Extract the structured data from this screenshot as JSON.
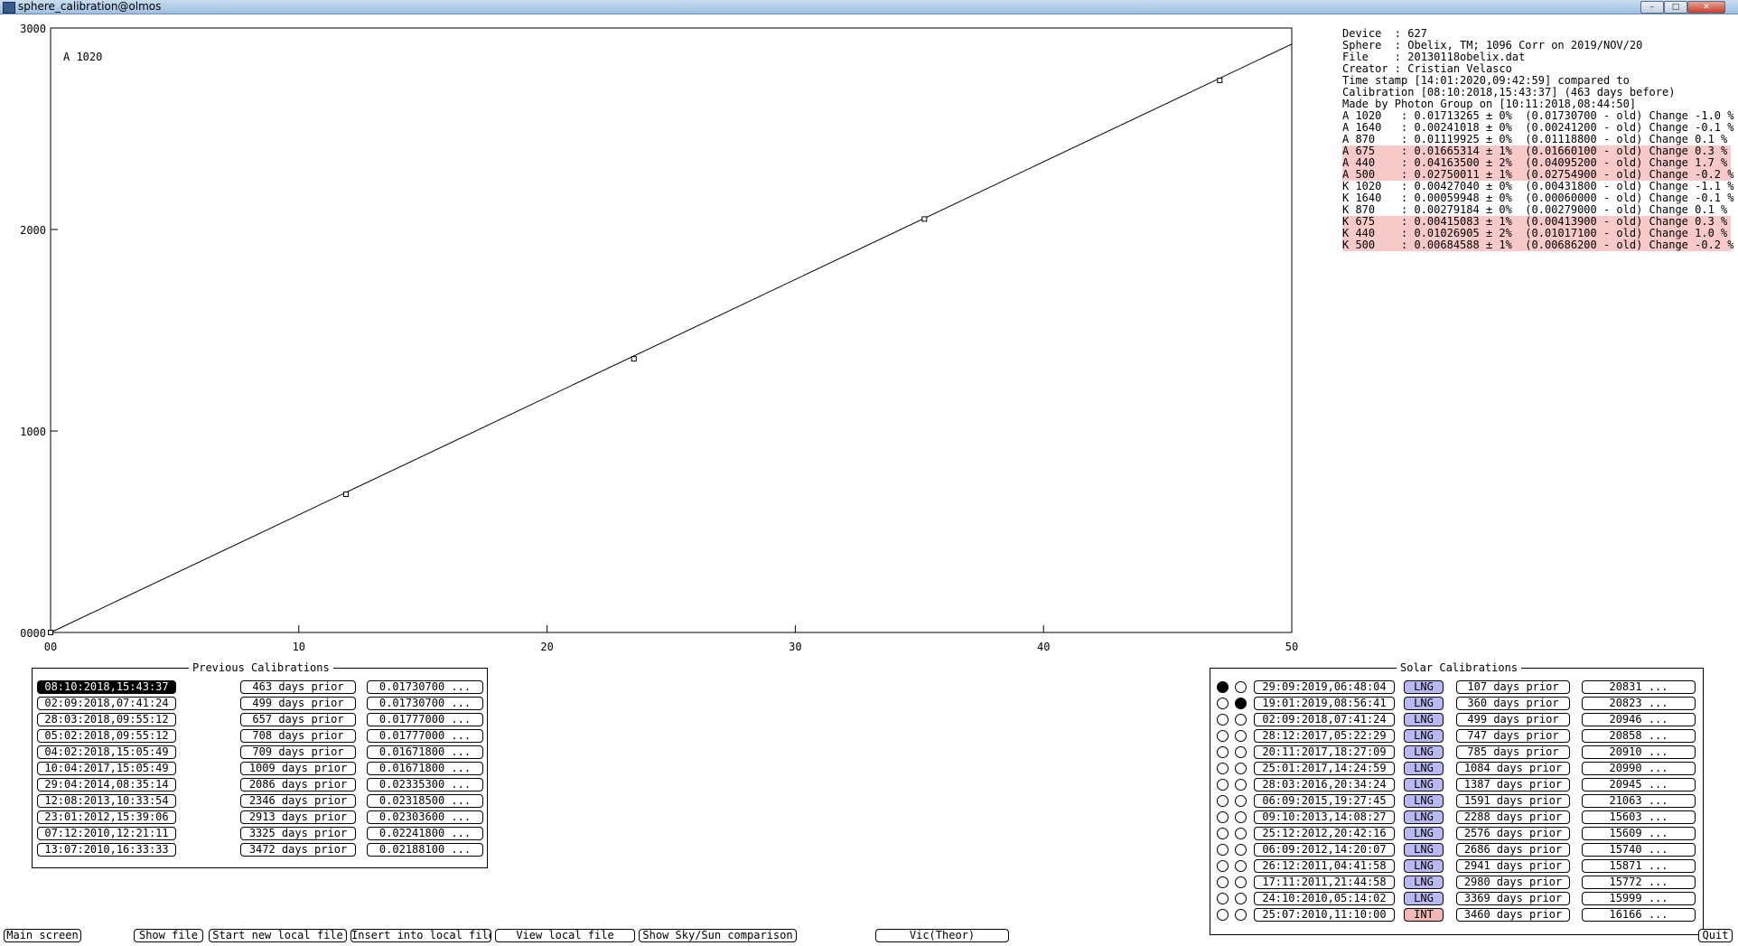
{
  "window": {
    "title": "sphere_calibration@olmos",
    "controls": [
      "minimize",
      "maximize",
      "close"
    ]
  },
  "chart_data": {
    "type": "scatter",
    "annotation": "A 1020",
    "xlim": [
      0,
      50
    ],
    "ylim": [
      0,
      3000
    ],
    "x_ticks": [
      "00",
      "10",
      "20",
      "30",
      "40",
      "50"
    ],
    "y_ticks": [
      "0000",
      "1000",
      "2000",
      "3000"
    ],
    "points": [
      {
        "x": 0,
        "y": 0
      },
      {
        "x": 11.9,
        "y": 686
      },
      {
        "x": 23.5,
        "y": 1358
      },
      {
        "x": 35.2,
        "y": 2052
      },
      {
        "x": 47.1,
        "y": 2740
      }
    ],
    "fit_line": {
      "x": [
        0,
        50
      ],
      "y": [
        0,
        2920
      ]
    },
    "grid": false,
    "legend": "none"
  },
  "info": {
    "lines": [
      "Device  : 627",
      "Sphere  : Obelix, TM; 1096 Corr on 2019/NOV/20",
      "File    : 20130118obelix.dat",
      "Creator : Cristian Velasco",
      "Time stamp [14:01:2020,09:42:59] compared to",
      "Calibration [08:10:2018,15:43:37] (463 days before)",
      "Made by Photon Group on [10:11:2018,08:44:50]"
    ],
    "coeffs": [
      {
        "text": "A 1020   : 0.01713265 ± 0%  (0.01730700 - old) Change -1.0 %",
        "highlight": false
      },
      {
        "text": "A 1640   : 0.00241018 ± 0%  (0.00241200 - old) Change -0.1 %",
        "highlight": false
      },
      {
        "text": "A 870    : 0.01119925 ± 0%  (0.01118800 - old) Change 0.1 %",
        "highlight": false
      },
      {
        "text": "A 675    : 0.01665314 ± 1%  (0.01660100 - old) Change 0.3 %",
        "highlight": true
      },
      {
        "text": "A 440    : 0.04163500 ± 2%  (0.04095200 - old) Change 1.7 %",
        "highlight": true
      },
      {
        "text": "A 500    : 0.02750011 ± 1%  (0.02754900 - old) Change -0.2 %",
        "highlight": true
      },
      {
        "text": "K 1020   : 0.00427040 ± 0%  (0.00431800 - old) Change -1.1 %",
        "highlight": false
      },
      {
        "text": "K 1640   : 0.00059948 ± 0%  (0.00060000 - old) Change -0.1 %",
        "highlight": false
      },
      {
        "text": "K 870    : 0.00279184 ± 0%  (0.00279000 - old) Change 0.1 %",
        "highlight": false
      },
      {
        "text": "K 675    : 0.00415083 ± 1%  (0.00413900 - old) Change 0.3 %",
        "highlight": true
      },
      {
        "text": "K 440    : 0.01026905 ± 2%  (0.01017100 - old) Change 1.0 %",
        "highlight": true
      },
      {
        "text": "K 500    : 0.00684588 ± 1%  (0.00686200 - old) Change -0.2 %",
        "highlight": true
      }
    ]
  },
  "previous": {
    "title": "Previous Calibrations",
    "rows": [
      {
        "date": "08:10:2018,15:43:37",
        "days": "463 days prior",
        "value": "0.01730700 ...",
        "selected": true
      },
      {
        "date": "02:09:2018,07:41:24",
        "days": "499 days prior",
        "value": "0.01730700 ...",
        "selected": false
      },
      {
        "date": "28:03:2018,09:55:12",
        "days": "657 days prior",
        "value": "0.01777000 ...",
        "selected": false
      },
      {
        "date": "05:02:2018,09:55:12",
        "days": "708 days prior",
        "value": "0.01777000 ...",
        "selected": false
      },
      {
        "date": "04:02:2018,15:05:49",
        "days": "709 days prior",
        "value": "0.01671800 ...",
        "selected": false
      },
      {
        "date": "10:04:2017,15:05:49",
        "days": "1009 days prior",
        "value": "0.01671800 ...",
        "selected": false
      },
      {
        "date": "29:04:2014,08:35:14",
        "days": "2086 days prior",
        "value": "0.02335300 ...",
        "selected": false
      },
      {
        "date": "12:08:2013,10:33:54",
        "days": "2346 days prior",
        "value": "0.02318500 ...",
        "selected": false
      },
      {
        "date": "23:01:2012,15:39:06",
        "days": "2913 days prior",
        "value": "0.02303600 ...",
        "selected": false
      },
      {
        "date": "07:12:2010,12:21:11",
        "days": "3325 days prior",
        "value": "0.02241800 ...",
        "selected": false
      },
      {
        "date": "13:07:2010,16:33:33",
        "days": "3472 days prior",
        "value": "0.02188100 ...",
        "selected": false
      }
    ]
  },
  "solar": {
    "title": "Solar Calibrations",
    "rows": [
      {
        "r1": true,
        "r2": false,
        "date": "29:09:2019,06:48:04",
        "type": "LNG",
        "days": "107 days prior",
        "value": "20831 ..."
      },
      {
        "r1": false,
        "r2": true,
        "date": "19:01:2019,08:56:41",
        "type": "LNG",
        "days": "360 days prior",
        "value": "20823 ..."
      },
      {
        "r1": false,
        "r2": false,
        "date": "02:09:2018,07:41:24",
        "type": "LNG",
        "days": "499 days prior",
        "value": "20946 ..."
      },
      {
        "r1": false,
        "r2": false,
        "date": "28:12:2017,05:22:29",
        "type": "LNG",
        "days": "747 days prior",
        "value": "20858 ..."
      },
      {
        "r1": false,
        "r2": false,
        "date": "20:11:2017,18:27:09",
        "type": "LNG",
        "days": "785 days prior",
        "value": "20910 ..."
      },
      {
        "r1": false,
        "r2": false,
        "date": "25:01:2017,14:24:59",
        "type": "LNG",
        "days": "1084 days prior",
        "value": "20990 ..."
      },
      {
        "r1": false,
        "r2": false,
        "date": "28:03:2016,20:34:24",
        "type": "LNG",
        "days": "1387 days prior",
        "value": "20945 ..."
      },
      {
        "r1": false,
        "r2": false,
        "date": "06:09:2015,19:27:45",
        "type": "LNG",
        "days": "1591 days prior",
        "value": "21063 ..."
      },
      {
        "r1": false,
        "r2": false,
        "date": "09:10:2013,14:08:27",
        "type": "LNG",
        "days": "2288 days prior",
        "value": "15603 ..."
      },
      {
        "r1": false,
        "r2": false,
        "date": "25:12:2012,20:42:16",
        "type": "LNG",
        "days": "2576 days prior",
        "value": "15609 ..."
      },
      {
        "r1": false,
        "r2": false,
        "date": "06:09:2012,14:20:07",
        "type": "LNG",
        "days": "2686 days prior",
        "value": "15740 ..."
      },
      {
        "r1": false,
        "r2": false,
        "date": "26:12:2011,04:41:58",
        "type": "LNG",
        "days": "2941 days prior",
        "value": "15871 ..."
      },
      {
        "r1": false,
        "r2": false,
        "date": "17:11:2011,21:44:58",
        "type": "LNG",
        "days": "2980 days prior",
        "value": "15772 ..."
      },
      {
        "r1": false,
        "r2": false,
        "date": "24:10:2010,05:14:02",
        "type": "LNG",
        "days": "3369 days prior",
        "value": "15999 ..."
      },
      {
        "r1": false,
        "r2": false,
        "date": "25:07:2010,11:10:00",
        "type": "INT",
        "days": "3460 days prior",
        "value": "16166 ..."
      }
    ]
  },
  "bottom_bar": {
    "main_screen": "Main screen",
    "show_file": "Show file",
    "start_new_local_file": "Start new local file",
    "insert_into_local_file": "Insert into local file",
    "view_local_file": "View local file",
    "show_sky_sun": "Show Sky/Sun comparison",
    "vic_theor": "Vic(Theor)",
    "quit": "Quit"
  },
  "colors": {
    "highlight": "#f7c9c9",
    "lng": "#b8b8f2",
    "int": "#f2b8b8"
  }
}
